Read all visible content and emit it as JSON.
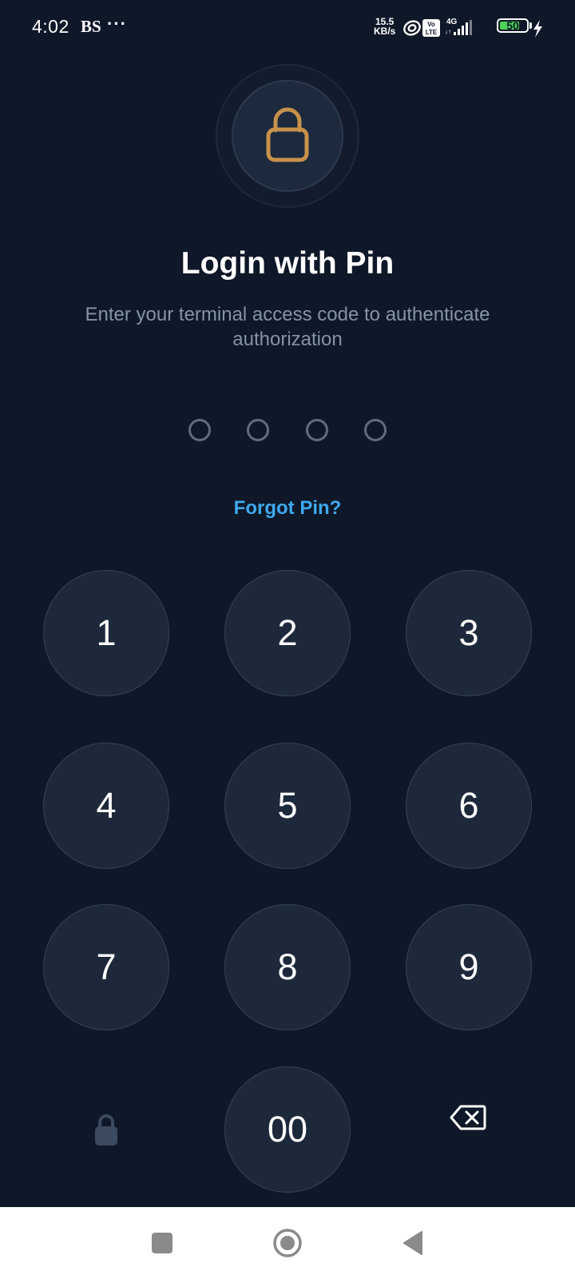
{
  "status_bar": {
    "time": "4:02",
    "carrier": "BS",
    "more": "···",
    "net_speed_value": "15.5",
    "net_speed_unit": "KB/s",
    "volte_label": "Vo LTE",
    "network_type": "4G",
    "battery_level": "50"
  },
  "auth": {
    "title": "Login with Pin",
    "subtitle": "Enter your terminal access code to authenticate authorization",
    "forgot_label": "Forgot Pin?",
    "pin_length": 4,
    "accent_color": "#3fa9ef",
    "lock_color": "#c8914a"
  },
  "keypad": {
    "keys": [
      "1",
      "2",
      "3",
      "4",
      "5",
      "6",
      "7",
      "8",
      "9",
      "00"
    ],
    "left_icon": "lock-icon",
    "right_icon": "backspace-icon"
  },
  "nav_bar": {
    "buttons": [
      "recents-icon",
      "home-icon",
      "back-icon"
    ]
  }
}
